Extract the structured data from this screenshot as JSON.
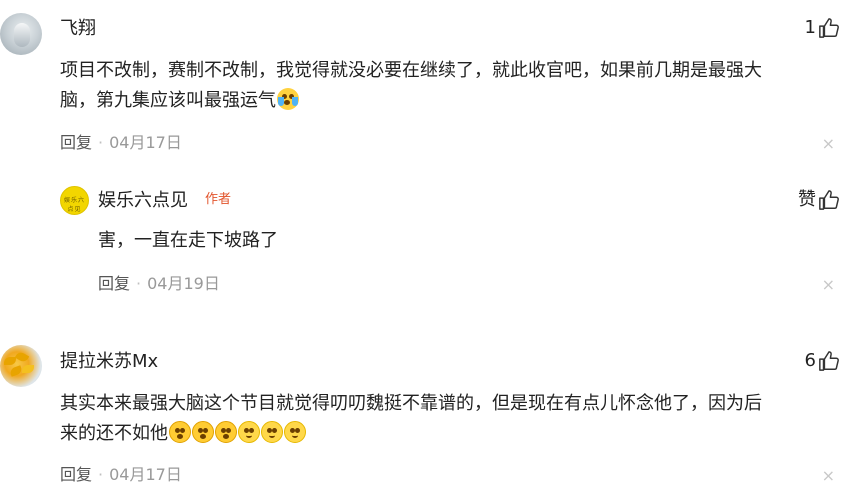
{
  "comments": [
    {
      "username": "飞翔",
      "likes": "1",
      "content_lines": [
        "项目不改制，赛制不改制，我觉得就没必要在继续了，就此收官吧，如果前几期是最强大",
        "脑，第九集应该叫最强运气"
      ],
      "emojis": [
        "crying-laughing-emoji"
      ],
      "reply_label": "回复",
      "date": "04月17日",
      "close_symbol": "×",
      "replies": [
        {
          "username": "娱乐六点见",
          "author_tag": "作者",
          "likes_label": "赞",
          "avatar_text": "娱乐六点见",
          "content": "害，一直在走下坡路了",
          "reply_label": "回复",
          "date": "04月19日",
          "close_symbol": "×"
        }
      ]
    },
    {
      "username": "提拉米苏Mx",
      "likes": "6",
      "content_lines": [
        "其实本来最强大脑这个节目就觉得叨叨魏挺不靠谱的，但是现在有点儿怀念他了，因为后",
        "来的还不如他"
      ],
      "emojis": [
        "shocked-emoji",
        "shocked-emoji",
        "shocked-emoji",
        "smiling-emoji",
        "smiling-emoji",
        "smiling-emoji"
      ],
      "reply_label": "回复",
      "date": "04月17日",
      "close_symbol": "×"
    }
  ],
  "separator": "·",
  "colors": {
    "text": "#222222",
    "meta": "#999999",
    "author_tag": "#e2552d",
    "author_avatar_bg": "#f2d600"
  }
}
